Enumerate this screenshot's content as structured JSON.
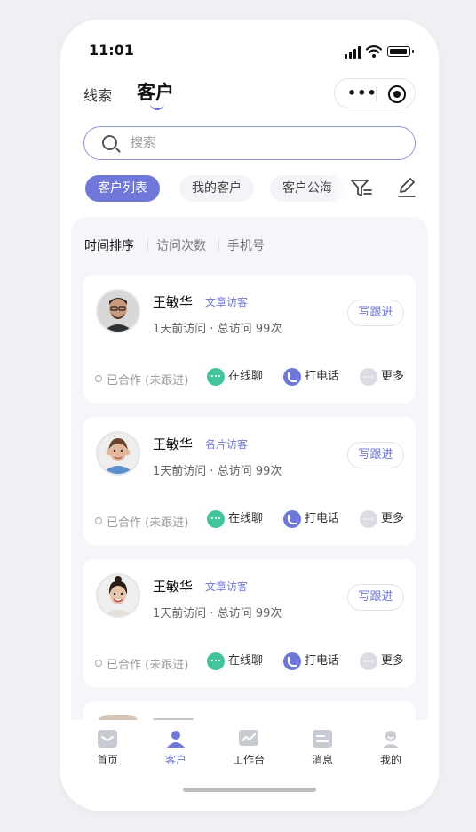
{
  "status_bar": {
    "time": "11:01"
  },
  "header": {
    "tabs": [
      "线索",
      "客户"
    ],
    "active_tab": "客户"
  },
  "search": {
    "placeholder": "搜索"
  },
  "filter_tabs": [
    "客户列表",
    "我的客户",
    "客户公海"
  ],
  "active_filter": "客户列表",
  "sort_options": [
    "时间排序",
    "访问次数",
    "手机号"
  ],
  "customers": [
    {
      "name": "王敏华",
      "tag": "文章访客",
      "last_visit": "1天前访问",
      "total_visits": "总访问 99次",
      "status": "已合作 (未跟进)",
      "follow_label": "写跟进",
      "actions": [
        "在线聊",
        "打电话",
        "更多"
      ]
    },
    {
      "name": "王敏华",
      "tag": "名片访客",
      "last_visit": "1天前访问",
      "total_visits": "总访问 99次",
      "status": "已合作 (未跟进)",
      "follow_label": "写跟进",
      "actions": [
        "在线聊",
        "打电话",
        "更多"
      ]
    },
    {
      "name": "王敏华",
      "tag": "文章访客",
      "last_visit": "1天前访问",
      "total_visits": "总访问 99次",
      "status": "已合作 (未跟进)",
      "follow_label": "写跟进",
      "actions": [
        "在线聊",
        "打电话",
        "更多"
      ]
    }
  ],
  "meta_separator": "·",
  "tab_bar": [
    "首页",
    "客户",
    "工作台",
    "消息",
    "我的"
  ],
  "active_tab_bar": "客户",
  "colors": {
    "accent": "#6f78d9",
    "chat": "#45c29e",
    "panel_bg": "#f5f6fa"
  }
}
